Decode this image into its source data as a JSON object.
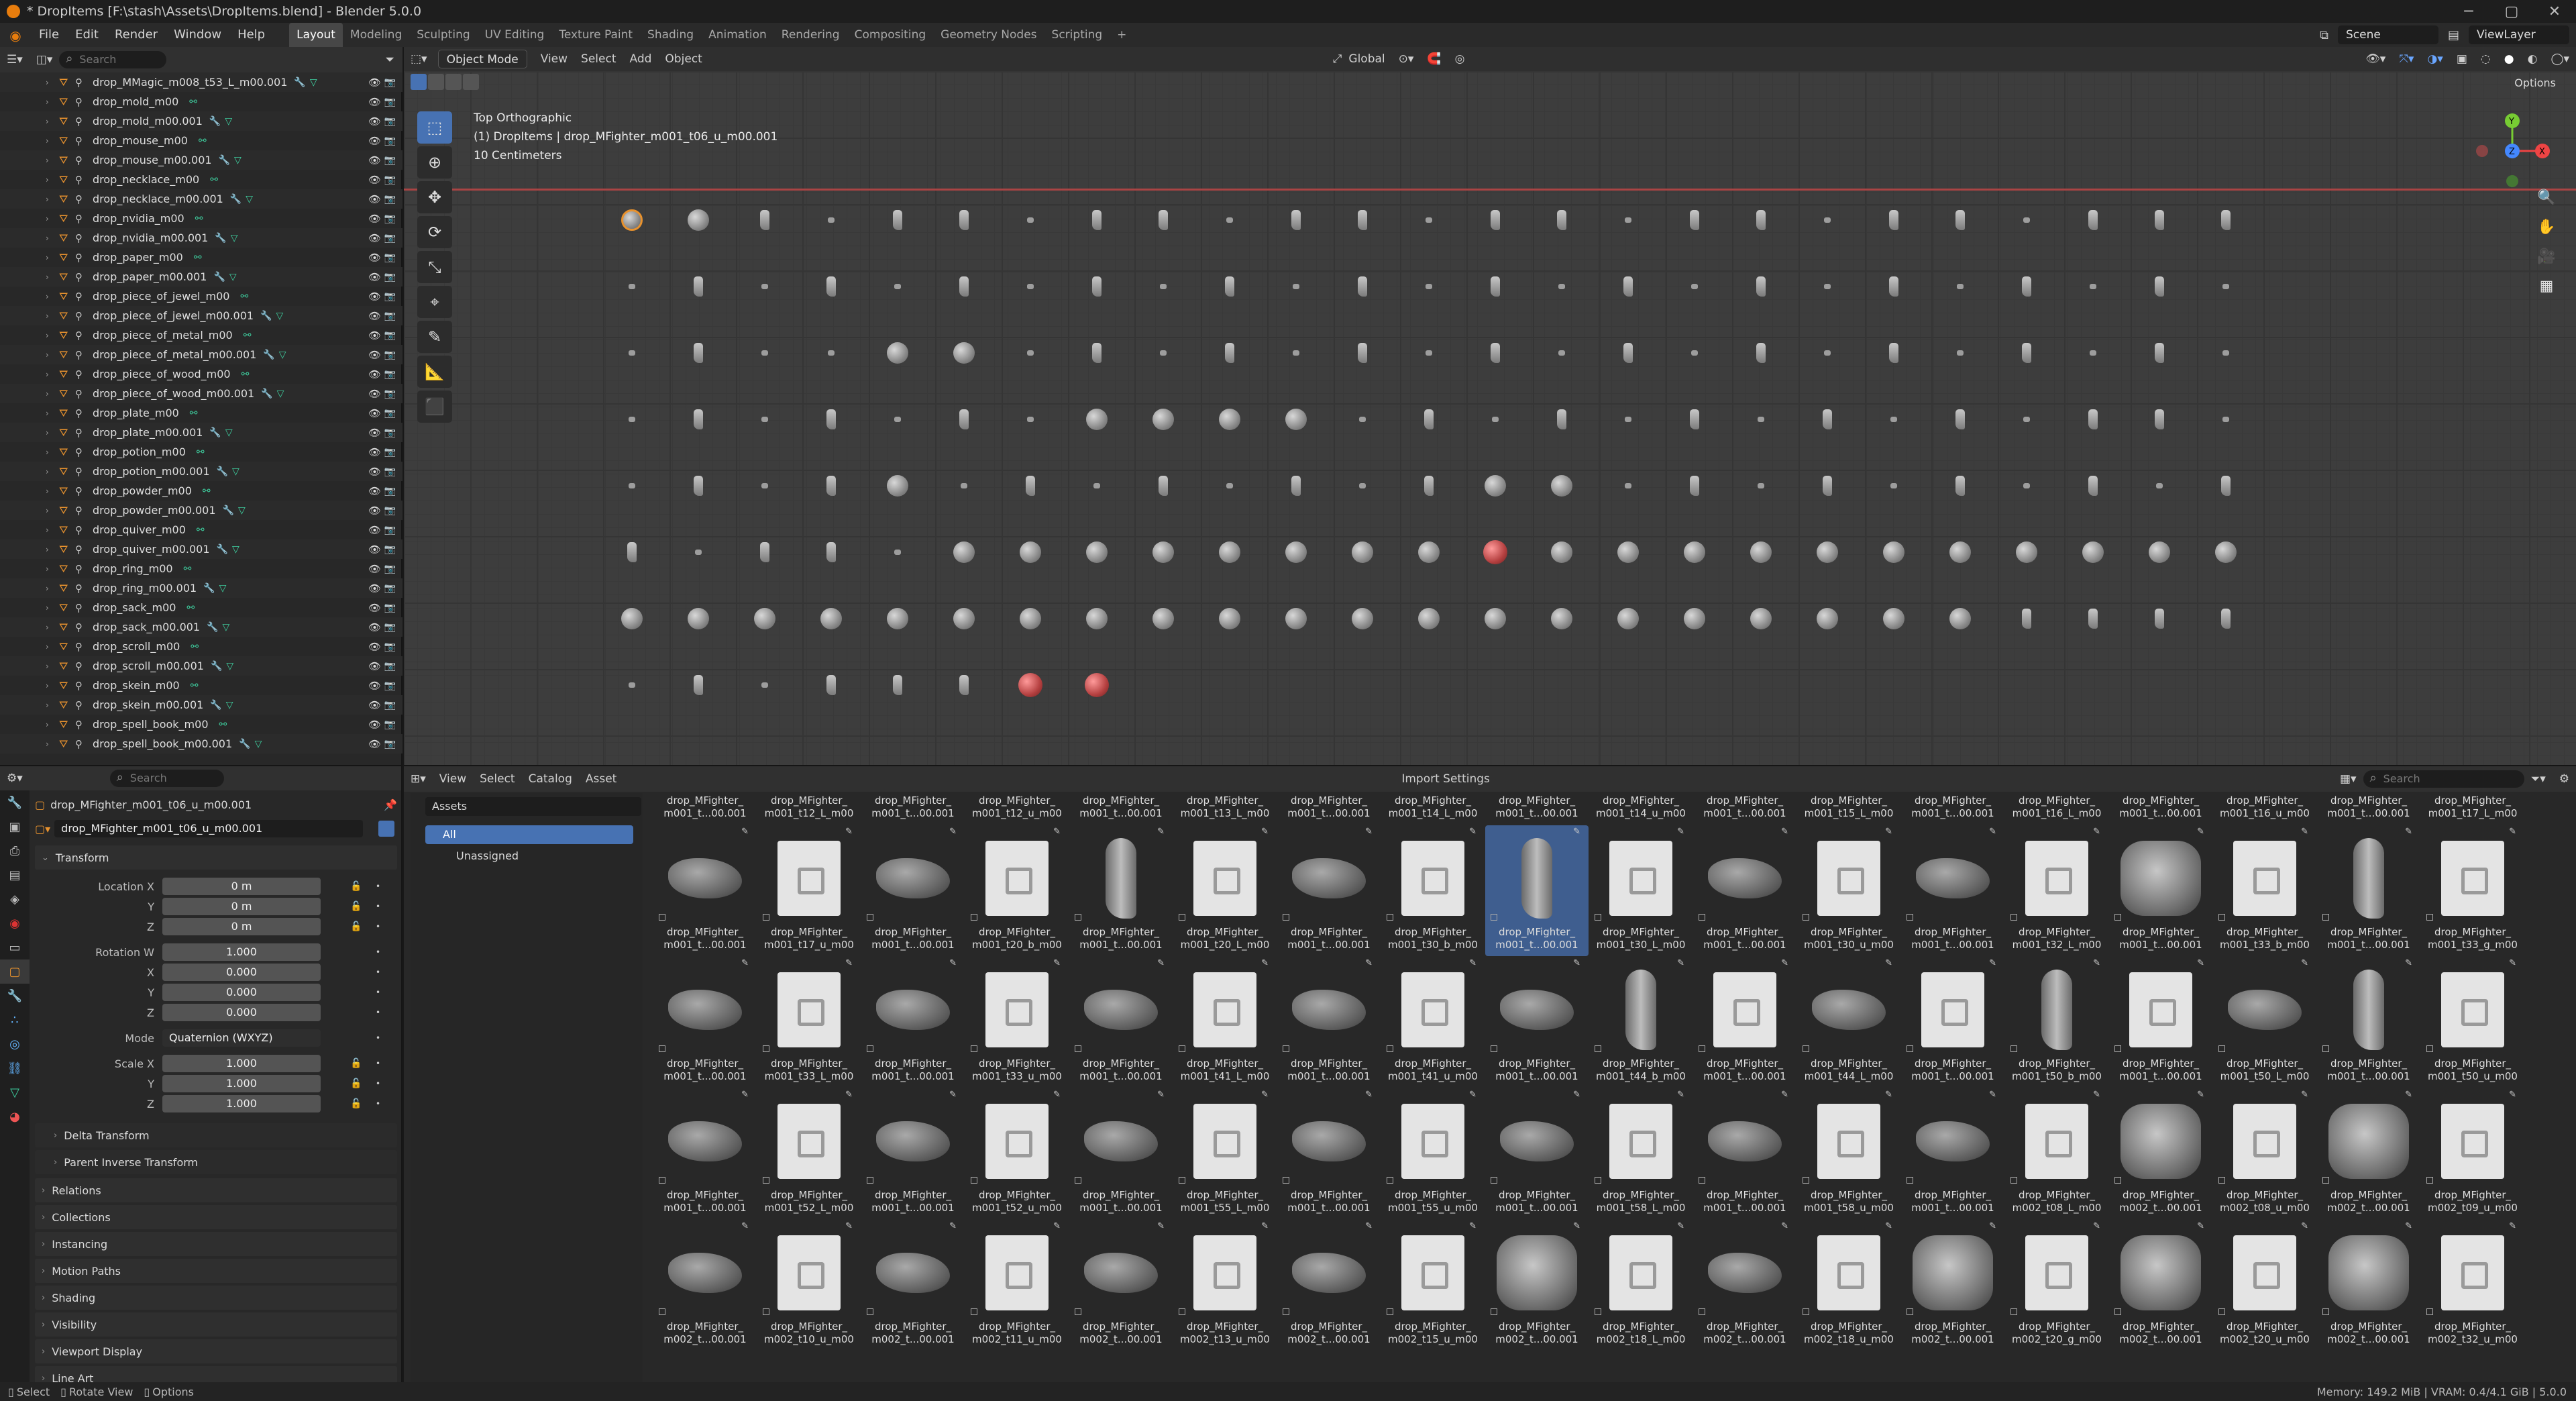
{
  "window": {
    "title": "* DropItems [F:\\stash\\Assets\\DropItems.blend] - Blender 5.0.0"
  },
  "menu": [
    "File",
    "Edit",
    "Render",
    "Window",
    "Help"
  ],
  "workspaces": [
    "Layout",
    "Modeling",
    "Sculpting",
    "UV Editing",
    "Texture Paint",
    "Shading",
    "Animation",
    "Rendering",
    "Compositing",
    "Geometry Nodes",
    "Scripting",
    "+"
  ],
  "scene": "Scene",
  "view_layer": "ViewLayer",
  "outliner": {
    "search_placeholder": "Search",
    "items": [
      "drop_MMagic_m008_t53_L_m00.001",
      "drop_mold_m00",
      "drop_mold_m00.001",
      "drop_mouse_m00",
      "drop_mouse_m00.001",
      "drop_necklace_m00",
      "drop_necklace_m00.001",
      "drop_nvidia_m00",
      "drop_nvidia_m00.001",
      "drop_paper_m00",
      "drop_paper_m00.001",
      "drop_piece_of_jewel_m00",
      "drop_piece_of_jewel_m00.001",
      "drop_piece_of_metal_m00",
      "drop_piece_of_metal_m00.001",
      "drop_piece_of_wood_m00",
      "drop_piece_of_wood_m00.001",
      "drop_plate_m00",
      "drop_plate_m00.001",
      "drop_potion_m00",
      "drop_potion_m00.001",
      "drop_powder_m00",
      "drop_powder_m00.001",
      "drop_quiver_m00",
      "drop_quiver_m00.001",
      "drop_ring_m00",
      "drop_ring_m00.001",
      "drop_sack_m00",
      "drop_sack_m00.001",
      "drop_scroll_m00",
      "drop_scroll_m00.001",
      "drop_skein_m00",
      "drop_skein_m00.001",
      "drop_spell_book_m00",
      "drop_spell_book_m00.001"
    ]
  },
  "viewport": {
    "mode": "Object Mode",
    "menus": [
      "View",
      "Select",
      "Add",
      "Object"
    ],
    "transform_orientation": "Global",
    "options": "Options",
    "overlay_line1": "Top Orthographic",
    "overlay_line2": "(1) DropItems | drop_MFighter_m001_t06_u_m00.001",
    "overlay_line3": "10 Centimeters"
  },
  "properties": {
    "search_placeholder": "Search",
    "object_name": "drop_MFighter_m001_t06_u_m00.001",
    "data_name": "drop_MFighter_m001_t06_u_m00.001",
    "transform_label": "Transform",
    "location": {
      "label_x": "Location X",
      "label_y": "Y",
      "label_z": "Z",
      "x": "0 m",
      "y": "0 m",
      "z": "0 m"
    },
    "rotation": {
      "label_w": "Rotation W",
      "label_x": "X",
      "label_y": "Y",
      "label_z": "Z",
      "w": "1.000",
      "x": "0.000",
      "y": "0.000",
      "z": "0.000"
    },
    "mode_label": "Mode",
    "mode_value": "Quaternion (WXYZ)",
    "scale": {
      "label_x": "Scale X",
      "label_y": "Y",
      "label_z": "Z",
      "x": "1.000",
      "y": "1.000",
      "z": "1.000"
    },
    "subpanels": [
      "Delta Transform",
      "Parent Inverse Transform"
    ],
    "panels": [
      "Relations",
      "Collections",
      "Instancing",
      "Motion Paths",
      "Shading",
      "Visibility",
      "Viewport Display",
      "Line Art"
    ]
  },
  "assets": {
    "menus": [
      "View",
      "Select",
      "Catalog",
      "Asset"
    ],
    "import_settings": "Import Settings",
    "search_placeholder": "Search",
    "library": "Assets",
    "catalog_all": "All",
    "catalog_unassigned": "Unassigned",
    "row0": [
      [
        "drop_MFighter_",
        "m001_t...00.001"
      ],
      [
        "drop_MFighter_",
        "m001_t12_L_m00"
      ],
      [
        "drop_MFighter_",
        "m001_t...00.001"
      ],
      [
        "drop_MFighter_",
        "m001_t12_u_m00"
      ],
      [
        "drop_MFighter_",
        "m001_t...00.001"
      ],
      [
        "drop_MFighter_",
        "m001_t13_L_m00"
      ],
      [
        "drop_MFighter_",
        "m001_t...00.001"
      ],
      [
        "drop_MFighter_",
        "m001_t14_L_m00"
      ],
      [
        "drop_MFighter_",
        "m001_t...00.001"
      ],
      [
        "drop_MFighter_",
        "m001_t14_u_m00"
      ],
      [
        "drop_MFighter_",
        "m001_t...00.001"
      ],
      [
        "drop_MFighter_",
        "m001_t15_L_m00"
      ],
      [
        "drop_MFighter_",
        "m001_t...00.001"
      ],
      [
        "drop_MFighter_",
        "m001_t16_L_m00"
      ],
      [
        "drop_MFighter_",
        "m001_t...00.001"
      ],
      [
        "drop_MFighter_",
        "m001_t16_u_m00"
      ],
      [
        "drop_MFighter_",
        "m001_t...00.001"
      ],
      [
        "drop_MFighter_",
        "m001_t17_L_m00"
      ]
    ],
    "row1": [
      [
        "drop_MFighter_",
        "m001_t...00.001"
      ],
      [
        "drop_MFighter_",
        "m001_t17_u_m00"
      ],
      [
        "drop_MFighter_",
        "m001_t...00.001"
      ],
      [
        "drop_MFighter_",
        "m001_t20_b_m00"
      ],
      [
        "drop_MFighter_",
        "m001_t...00.001"
      ],
      [
        "drop_MFighter_",
        "m001_t20_L_m00"
      ],
      [
        "drop_MFighter_",
        "m001_t...00.001"
      ],
      [
        "drop_MFighter_",
        "m001_t30_b_m00"
      ],
      [
        "drop_MFighter_",
        "m001_t...00.001"
      ],
      [
        "drop_MFighter_",
        "m001_t30_L_m00"
      ],
      [
        "drop_MFighter_",
        "m001_t...00.001"
      ],
      [
        "drop_MFighter_",
        "m001_t30_u_m00"
      ],
      [
        "drop_MFighter_",
        "m001_t...00.001"
      ],
      [
        "drop_MFighter_",
        "m001_t32_L_m00"
      ],
      [
        "drop_MFighter_",
        "m001_t...00.001"
      ],
      [
        "drop_MFighter_",
        "m001_t33_b_m00"
      ],
      [
        "drop_MFighter_",
        "m001_t...00.001"
      ],
      [
        "drop_MFighter_",
        "m001_t33_g_m00"
      ]
    ],
    "row2": [
      [
        "drop_MFighter_",
        "m001_t...00.001"
      ],
      [
        "drop_MFighter_",
        "m001_t33_L_m00"
      ],
      [
        "drop_MFighter_",
        "m001_t...00.001"
      ],
      [
        "drop_MFighter_",
        "m001_t33_u_m00"
      ],
      [
        "drop_MFighter_",
        "m001_t...00.001"
      ],
      [
        "drop_MFighter_",
        "m001_t41_L_m00"
      ],
      [
        "drop_MFighter_",
        "m001_t...00.001"
      ],
      [
        "drop_MFighter_",
        "m001_t41_u_m00"
      ],
      [
        "drop_MFighter_",
        "m001_t...00.001"
      ],
      [
        "drop_MFighter_",
        "m001_t44_b_m00"
      ],
      [
        "drop_MFighter_",
        "m001_t...00.001"
      ],
      [
        "drop_MFighter_",
        "m001_t44_L_m00"
      ],
      [
        "drop_MFighter_",
        "m001_t...00.001"
      ],
      [
        "drop_MFighter_",
        "m001_t50_b_m00"
      ],
      [
        "drop_MFighter_",
        "m001_t...00.001"
      ],
      [
        "drop_MFighter_",
        "m001_t50_L_m00"
      ],
      [
        "drop_MFighter_",
        "m001_t...00.001"
      ],
      [
        "drop_MFighter_",
        "m001_t50_u_m00"
      ]
    ],
    "row3": [
      [
        "drop_MFighter_",
        "m001_t...00.001"
      ],
      [
        "drop_MFighter_",
        "m001_t52_L_m00"
      ],
      [
        "drop_MFighter_",
        "m001_t...00.001"
      ],
      [
        "drop_MFighter_",
        "m001_t52_u_m00"
      ],
      [
        "drop_MFighter_",
        "m001_t...00.001"
      ],
      [
        "drop_MFighter_",
        "m001_t55_L_m00"
      ],
      [
        "drop_MFighter_",
        "m001_t...00.001"
      ],
      [
        "drop_MFighter_",
        "m001_t55_u_m00"
      ],
      [
        "drop_MFighter_",
        "m001_t...00.001"
      ],
      [
        "drop_MFighter_",
        "m001_t58_L_m00"
      ],
      [
        "drop_MFighter_",
        "m001_t...00.001"
      ],
      [
        "drop_MFighter_",
        "m001_t58_u_m00"
      ],
      [
        "drop_MFighter_",
        "m001_t...00.001"
      ],
      [
        "drop_MFighter_",
        "m002_t08_L_m00"
      ],
      [
        "drop_MFighter_",
        "m002_t...00.001"
      ],
      [
        "drop_MFighter_",
        "m002_t08_u_m00"
      ],
      [
        "drop_MFighter_",
        "m002_t...00.001"
      ],
      [
        "drop_MFighter_",
        "m002_t09_u_m00"
      ]
    ],
    "row4": [
      [
        "drop_MFighter_",
        "m002_t...00.001"
      ],
      [
        "drop_MFighter_",
        "m002_t10_u_m00"
      ],
      [
        "drop_MFighter_",
        "m002_t...00.001"
      ],
      [
        "drop_MFighter_",
        "m002_t11_u_m00"
      ],
      [
        "drop_MFighter_",
        "m002_t...00.001"
      ],
      [
        "drop_MFighter_",
        "m002_t13_u_m00"
      ],
      [
        "drop_MFighter_",
        "m002_t...00.001"
      ],
      [
        "drop_MFighter_",
        "m002_t15_u_m00"
      ],
      [
        "drop_MFighter_",
        "m002_t...00.001"
      ],
      [
        "drop_MFighter_",
        "m002_t18_L_m00"
      ],
      [
        "drop_MFighter_",
        "m002_t...00.001"
      ],
      [
        "drop_MFighter_",
        "m002_t18_u_m00"
      ],
      [
        "drop_MFighter_",
        "m002_t...00.001"
      ],
      [
        "drop_MFighter_",
        "m002_t20_g_m00"
      ],
      [
        "drop_MFighter_",
        "m002_t...00.001"
      ],
      [
        "drop_MFighter_",
        "m002_t20_u_m00"
      ],
      [
        "drop_MFighter_",
        "m002_t...00.001"
      ],
      [
        "drop_MFighter_",
        "m002_t32_u_m00"
      ]
    ]
  },
  "status": {
    "select": "Select",
    "rotate": "Rotate View",
    "options": "Options",
    "memory": "Memory: 149.2 MiB | VRAM: 0.4/4.1 GiB | 5.0.0"
  }
}
